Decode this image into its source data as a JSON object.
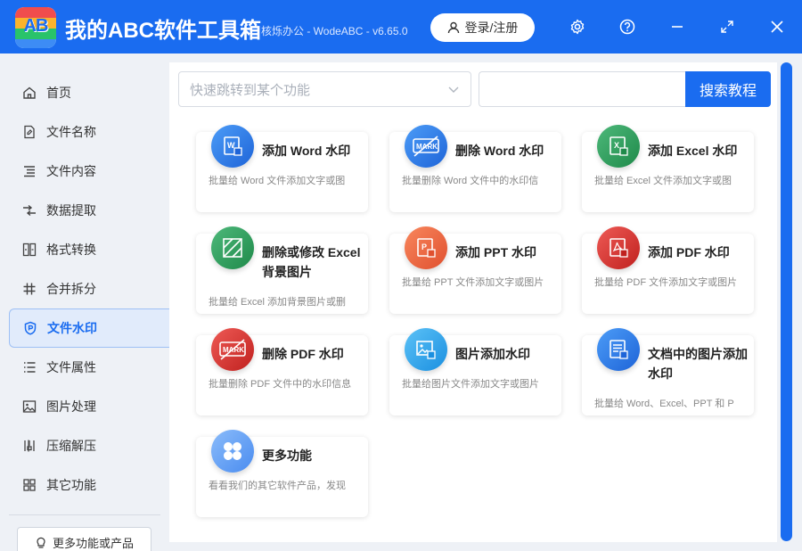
{
  "app": {
    "logo_text": "AB",
    "title": "我的ABC软件工具箱",
    "subtitle": "核烁办公 - WodeABC - v6.65.0",
    "login_label": "登录/注册",
    "brand_color": "#1a6cf0"
  },
  "sidebar": {
    "items": [
      {
        "label": "首页",
        "icon": "home-icon"
      },
      {
        "label": "文件名称",
        "icon": "file-name-icon"
      },
      {
        "label": "文件内容",
        "icon": "file-content-icon"
      },
      {
        "label": "数据提取",
        "icon": "data-extract-icon"
      },
      {
        "label": "格式转换",
        "icon": "format-convert-icon"
      },
      {
        "label": "合并拆分",
        "icon": "merge-split-icon"
      },
      {
        "label": "文件水印",
        "icon": "watermark-shield-icon",
        "active": true
      },
      {
        "label": "文件属性",
        "icon": "file-properties-icon"
      },
      {
        "label": "图片处理",
        "icon": "image-process-icon"
      },
      {
        "label": "压缩解压",
        "icon": "compress-icon"
      },
      {
        "label": "其它功能",
        "icon": "other-functions-icon"
      }
    ],
    "more_products_label": "更多功能或产品"
  },
  "main": {
    "jump_placeholder": "快速跳转到某个功能",
    "search_value": "",
    "search_button_label": "搜索教程",
    "cards": [
      {
        "title": "添加 Word 水印",
        "desc": "批量给 Word 文件添加文字或图",
        "icon": "word-icon",
        "color": "#2f7de8"
      },
      {
        "title": "删除 Word 水印",
        "desc": "批量删除 Word 文件中的水印信",
        "icon": "mark-remove-icon",
        "color": "#2f7de8"
      },
      {
        "title": "添加 Excel 水印",
        "desc": "批量给 Excel 文件添加文字或图",
        "icon": "excel-icon",
        "color": "#2e9a57"
      },
      {
        "title": "删除或修改 Excel 背景图片",
        "desc": "批量给 Excel 添加背景图片或删",
        "icon": "excel-background-icon",
        "color": "#2e9a57"
      },
      {
        "title": "添加 PPT 水印",
        "desc": "批量给 PPT 文件添加文字或图片",
        "icon": "ppt-icon",
        "color": "#ee6b45"
      },
      {
        "title": "添加 PDF 水印",
        "desc": "批量给 PDF 文件添加文字或图片",
        "icon": "pdf-icon",
        "color": "#d93a36"
      },
      {
        "title": "删除 PDF 水印",
        "desc": "批量删除 PDF 文件中的水印信息",
        "icon": "pdf-mark-remove-icon",
        "color": "#d93a36"
      },
      {
        "title": "图片添加水印",
        "desc": "批量给图片文件添加文字或图片",
        "icon": "image-watermark-icon",
        "color": "#2ba4ea"
      },
      {
        "title": "文档中的图片添加水印",
        "desc": "批量给 Word、Excel、PPT 和 P",
        "icon": "doc-image-watermark-icon",
        "color": "#2f7de8"
      },
      {
        "title": "更多功能",
        "desc": "看看我们的其它软件产品，发现",
        "icon": "more-grid-icon",
        "color": "#5d9cf5"
      }
    ]
  }
}
